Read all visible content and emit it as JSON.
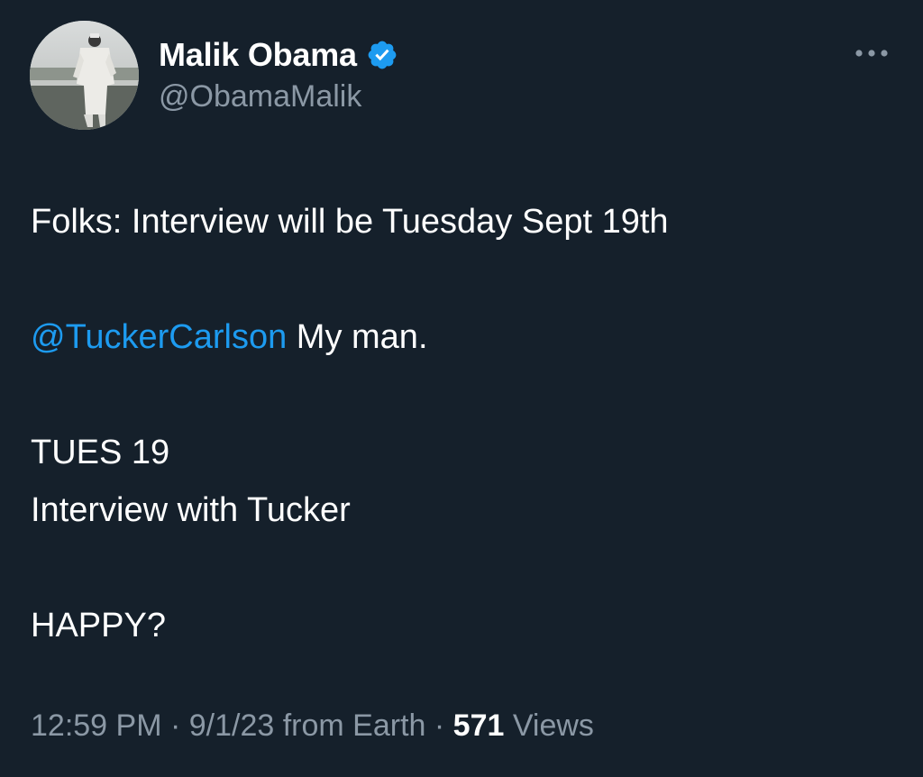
{
  "author": {
    "display_name": "Malik Obama",
    "handle": "@ObamaMalik",
    "verified": true,
    "verified_color": "#1d9bf0"
  },
  "more_icon": "more-horizontal-icon",
  "tweet": {
    "line1": "Folks: Interview will be Tuesday Sept 19th",
    "mention": "@TuckerCarlson",
    "mention_rest": " My man.",
    "line3": "TUES 19",
    "line4": "Interview with Tucker",
    "line5": "HAPPY?"
  },
  "meta": {
    "time": "12:59 PM",
    "sep1": " · ",
    "date_source": "9/1/23 from Earth",
    "sep2": " · ",
    "views_count": "571",
    "views_label": " Views"
  },
  "colors": {
    "background": "#15202b",
    "text": "#ffffff",
    "secondary": "#8b98a5",
    "link": "#1d9bf0"
  }
}
